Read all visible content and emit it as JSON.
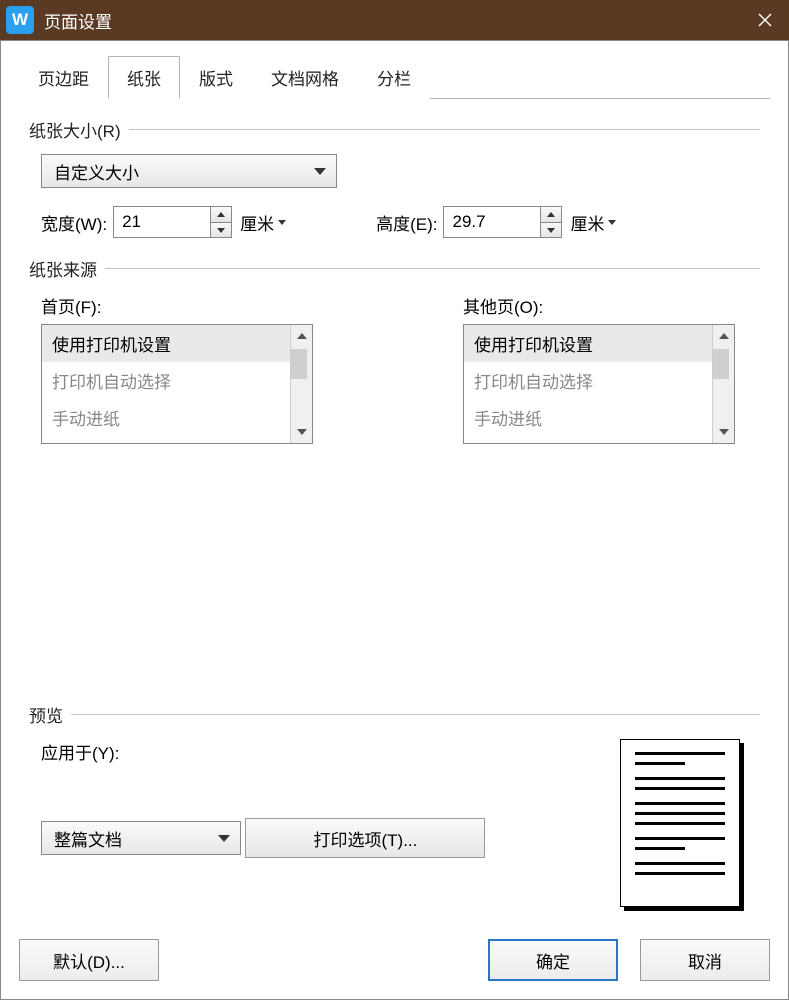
{
  "titlebar": {
    "app_glyph": "W",
    "title": "页面设置"
  },
  "tabs": [
    {
      "label": "页边距"
    },
    {
      "label": "纸张",
      "active": true
    },
    {
      "label": "版式"
    },
    {
      "label": "文档网格"
    },
    {
      "label": "分栏"
    }
  ],
  "paper_size": {
    "legend": "纸张大小(R)",
    "value": "自定义大小",
    "width_label": "宽度(W):",
    "width_value": "21",
    "width_unit": "厘米",
    "height_label": "高度(E):",
    "height_value": "29.7",
    "height_unit": "厘米"
  },
  "paper_source": {
    "legend": "纸张来源",
    "first_label": "首页(F):",
    "other_label": "其他页(O):",
    "items": [
      {
        "label": "使用打印机设置",
        "selected": true
      },
      {
        "label": "打印机自动选择"
      },
      {
        "label": "手动进纸"
      }
    ]
  },
  "preview": {
    "legend": "预览",
    "apply_label": "应用于(Y):",
    "apply_value": "整篇文档",
    "print_options_label": "打印选项(T)..."
  },
  "buttons": {
    "default": "默认(D)...",
    "ok": "确定",
    "cancel": "取消"
  }
}
